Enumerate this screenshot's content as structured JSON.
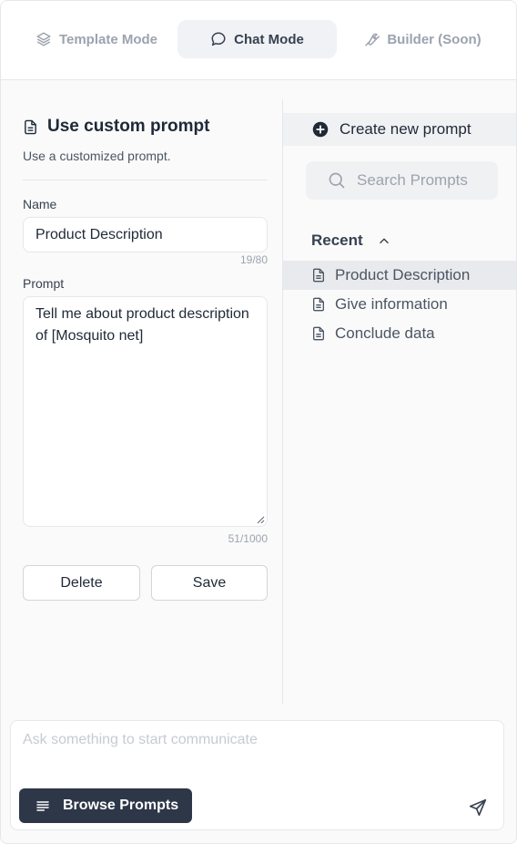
{
  "tabs": [
    {
      "label": "Template Mode",
      "icon": "layers-icon",
      "active": false
    },
    {
      "label": "Chat Mode",
      "icon": "chat-bubble-icon",
      "active": true
    },
    {
      "label": "Builder (Soon)",
      "icon": "wrench-icon",
      "active": false
    }
  ],
  "custom_prompt": {
    "title": "Use custom prompt",
    "subtitle": "Use a customized prompt.",
    "name_label": "Name",
    "name_value": "Product Description",
    "name_count": "19/80",
    "prompt_label": "Prompt",
    "prompt_value": "Tell me about product description of [Mosquito net]",
    "prompt_count": "51/1000",
    "delete_label": "Delete",
    "save_label": "Save"
  },
  "prompts_panel": {
    "create_label": "Create new prompt",
    "search_placeholder": "Search Prompts",
    "recent_label": "Recent",
    "items": [
      {
        "label": "Product Description",
        "active": true
      },
      {
        "label": "Give information",
        "active": false
      },
      {
        "label": "Conclude data",
        "active": false
      }
    ]
  },
  "composer": {
    "placeholder": "Ask something to start communicate",
    "browse_label": "Browse Prompts"
  },
  "colors": {
    "accent_dark": "#2d3748",
    "active_tab_bg": "#f0f2f5",
    "muted_text": "#9ca3af"
  }
}
